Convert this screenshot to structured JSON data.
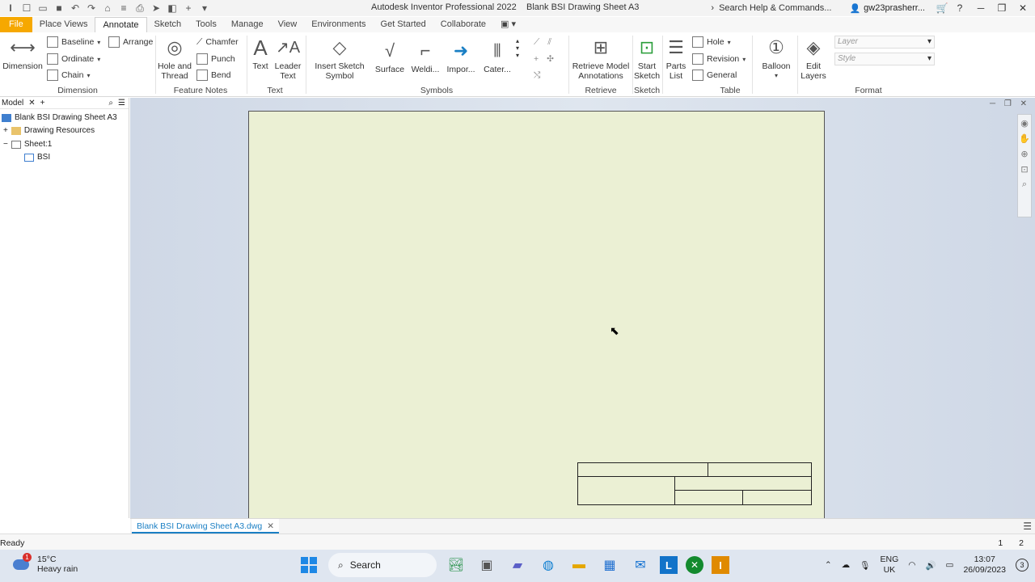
{
  "window": {
    "app_title": "Autodesk Inventor Professional 2022",
    "doc_title": "Blank BSI Drawing Sheet A3",
    "search_help": "Search Help & Commands...",
    "user": "gw23prasherr..."
  },
  "tabs": [
    "File",
    "Place Views",
    "Annotate",
    "Sketch",
    "Tools",
    "Manage",
    "View",
    "Environments",
    "Get Started",
    "Collaborate"
  ],
  "ribbon": {
    "dimension": {
      "big_label": "Dimension",
      "baseline": "Baseline",
      "arrange": "Arrange",
      "ordinate": "Ordinate",
      "chain": "Chain",
      "panel": "Dimension"
    },
    "feature_notes": {
      "hole_thread": "Hole and Thread",
      "chamfer": "Chamfer",
      "punch": "Punch",
      "bend": "Bend",
      "panel": "Feature Notes"
    },
    "text": {
      "text": "Text",
      "leader_text": "Leader Text",
      "panel": "Text"
    },
    "symbols": {
      "insert_sketch_symbol": "Insert Sketch Symbol",
      "surface": "Surface",
      "welding": "Weldi...",
      "import": "Impor...",
      "caterpillar": "Cater...",
      "panel": "Symbols"
    },
    "retrieve": {
      "retrieve_model": "Retrieve Model Annotations",
      "panel": "Retrieve"
    },
    "sketch": {
      "start_sketch": "Start Sketch",
      "panel": "Sketch"
    },
    "table": {
      "parts_list": "Parts List",
      "hole": "Hole",
      "revision": "Revision",
      "general": "General",
      "panel": "Table"
    },
    "balloon": {
      "balloon": "Balloon"
    },
    "format": {
      "edit_layers": "Edit Layers",
      "layer_placeholder": "Layer",
      "style_placeholder": "Style",
      "panel": "Format"
    }
  },
  "browser": {
    "tab": "Model",
    "items": [
      {
        "label": "Blank BSI Drawing Sheet A3"
      },
      {
        "label": "Drawing Resources"
      },
      {
        "label": "Sheet:1"
      },
      {
        "label": "BSI"
      }
    ]
  },
  "document_tab": "Blank BSI Drawing Sheet A3.dwg",
  "status": {
    "text": "Ready",
    "page1": "1",
    "page2": "2"
  },
  "taskbar": {
    "temperature": "15°C",
    "weather": "Heavy rain",
    "weather_badge": "1",
    "search": "Search",
    "lang": "ENG",
    "region": "UK",
    "time": "13:07",
    "date": "26/09/2023",
    "notifications": "3"
  },
  "colors": {
    "file_tab": "#f6a800",
    "sheet": "#ebf0d4",
    "canvas": "#d6dee9",
    "accent": "#1a7fc4"
  }
}
